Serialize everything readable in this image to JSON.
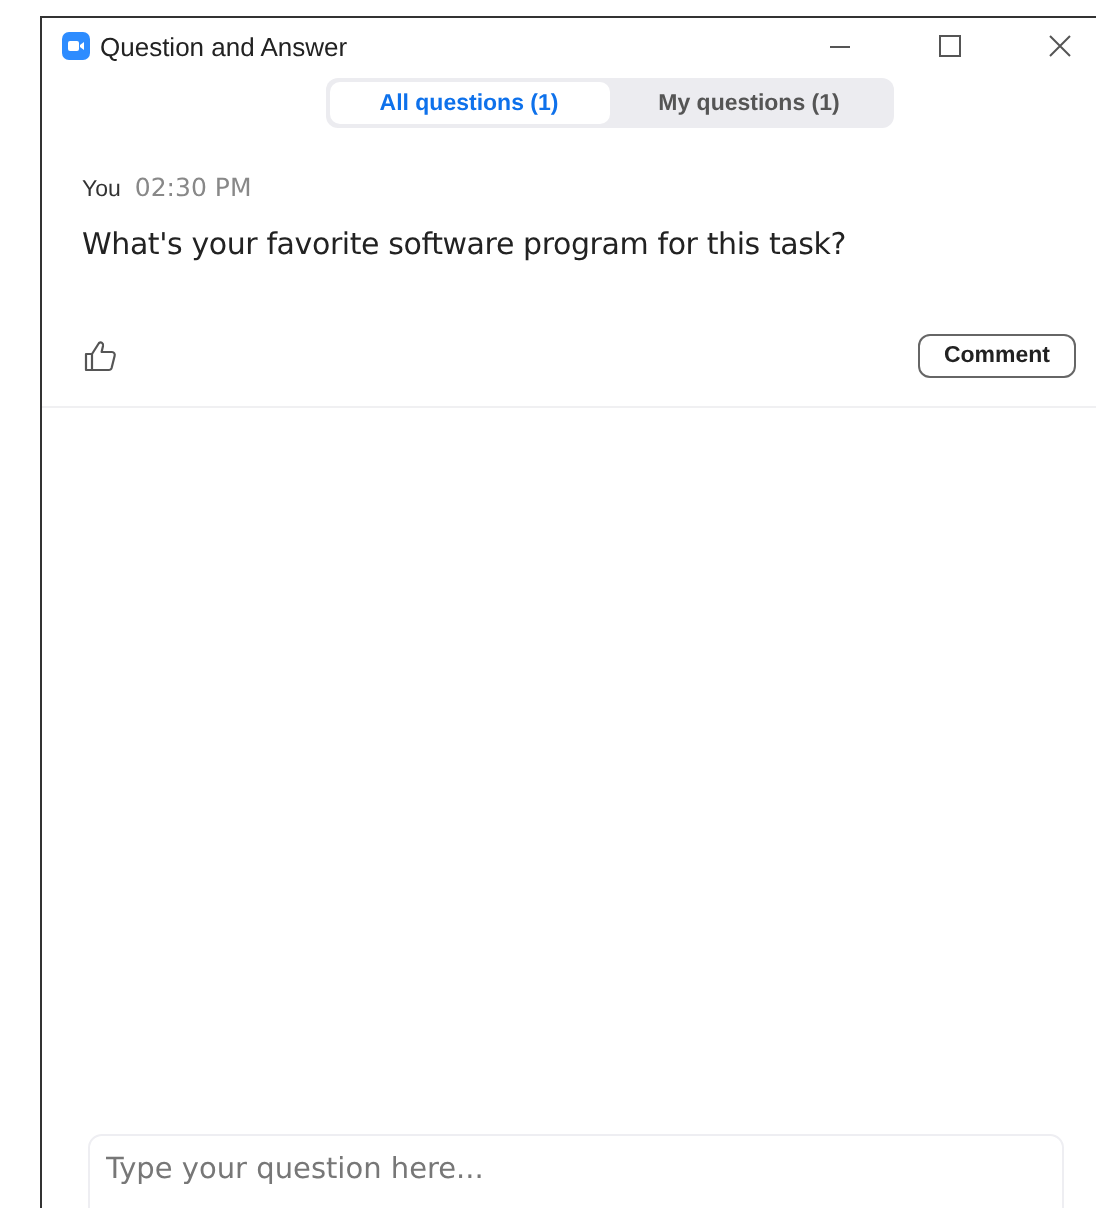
{
  "window": {
    "title": "Question and Answer"
  },
  "tabs": [
    {
      "label": "All questions (1)",
      "selected": true
    },
    {
      "label": "My questions (1)",
      "selected": false
    }
  ],
  "questions": [
    {
      "author": "You",
      "time": "02:30 PM",
      "text": "What's your favorite software program for this task?",
      "comment_button": "Comment"
    }
  ],
  "input": {
    "placeholder": "Type your question here..."
  }
}
